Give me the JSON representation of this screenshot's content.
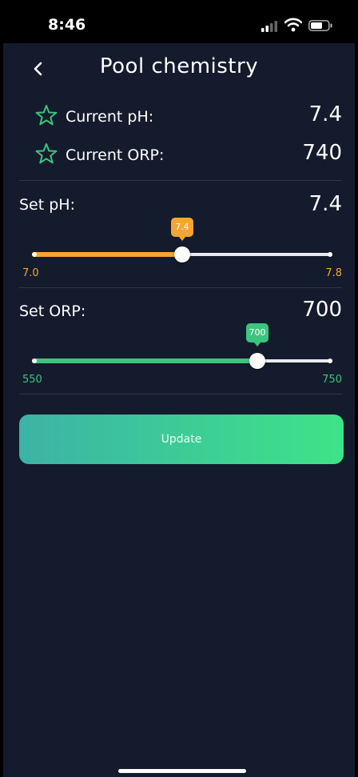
{
  "status_bar": {
    "time": "8:46",
    "icons": [
      "signal-icon",
      "wifi-icon",
      "battery-icon"
    ]
  },
  "header": {
    "back_icon": "chevron-left-icon",
    "title": "Pool chemistry"
  },
  "readings": [
    {
      "icon": "star-outline-icon",
      "label": "Current pH:",
      "value": "7.4"
    },
    {
      "icon": "star-outline-icon",
      "label": "Current ORP:",
      "value": "740"
    }
  ],
  "ph_setting": {
    "label": "Set pH:",
    "value": "7.4",
    "bubble": "7.4",
    "min_label": "7.0",
    "max_label": "7.8",
    "min": 7.0,
    "max": 7.8,
    "current": 7.4,
    "color": "#f5a533"
  },
  "orp_setting": {
    "label": "Set ORP:",
    "value": "700",
    "bubble": "700",
    "min_label": "550",
    "max_label": "750",
    "min": 550,
    "max": 750,
    "current": 700,
    "color": "#3dc47e"
  },
  "update_button": {
    "label": "Update",
    "gradient": [
      "#3cb3a6",
      "#3ee388"
    ]
  },
  "colors": {
    "background": "#141b2d",
    "star": "#3dc47e",
    "divider": "#2f3648"
  }
}
